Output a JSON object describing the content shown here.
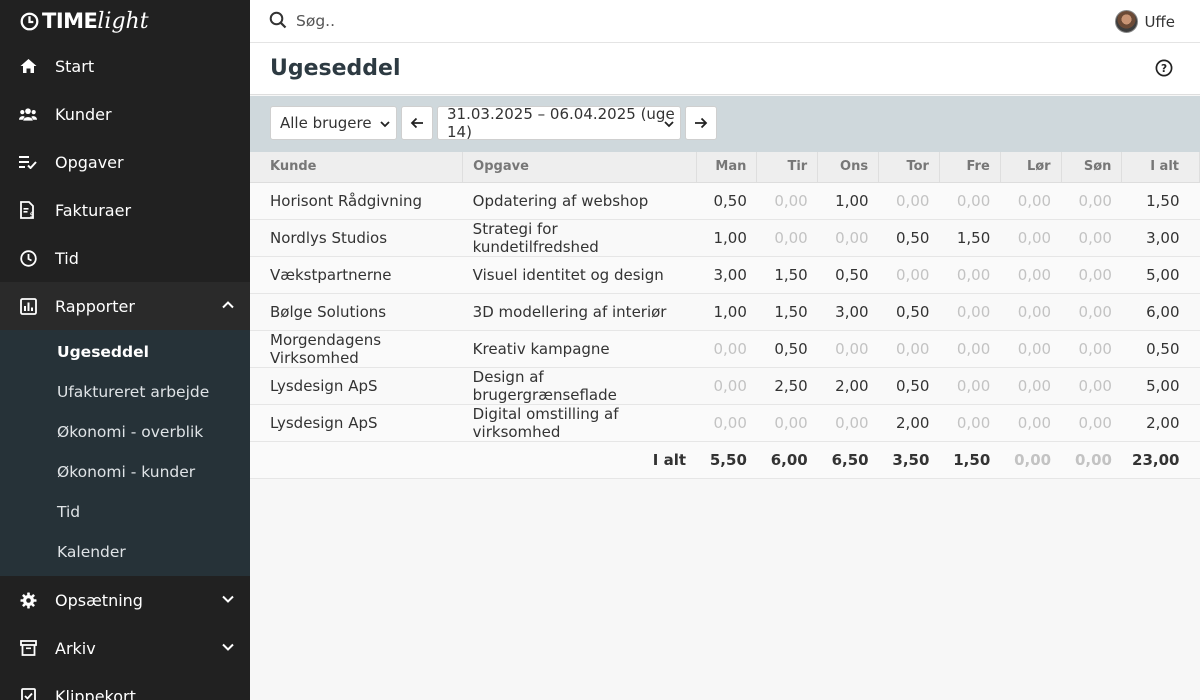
{
  "app": {
    "logo_bold": "TIME",
    "logo_light": "light"
  },
  "sidebar": {
    "items": [
      {
        "label": "Start",
        "icon": "home-icon"
      },
      {
        "label": "Kunder",
        "icon": "users-icon"
      },
      {
        "label": "Opgaver",
        "icon": "tasks-icon"
      },
      {
        "label": "Fakturaer",
        "icon": "invoice-icon"
      },
      {
        "label": "Tid",
        "icon": "clock-icon"
      },
      {
        "label": "Rapporter",
        "icon": "chart-icon",
        "expanded": true
      },
      {
        "label": "Opsætning",
        "icon": "gear-icon"
      },
      {
        "label": "Arkiv",
        "icon": "archive-icon"
      },
      {
        "label": "Klippekort",
        "icon": "card-icon"
      }
    ],
    "sub_items": [
      "Ugeseddel",
      "Ufaktureret arbejde",
      "Økonomi - overblik",
      "Økonomi - kunder",
      "Tid",
      "Kalender"
    ],
    "active_sub": "Ugeseddel"
  },
  "topbar": {
    "search_placeholder": "Søg..",
    "user_name": "Uffe"
  },
  "page": {
    "title": "Ugeseddel"
  },
  "toolbar": {
    "user_filter": "Alle brugere",
    "week_range": "31.03.2025 – 06.04.2025 (uge 14)"
  },
  "table": {
    "headers": [
      "Kunde",
      "Opgave",
      "Man",
      "Tir",
      "Ons",
      "Tor",
      "Fre",
      "Lør",
      "Søn",
      "I alt"
    ],
    "rows": [
      {
        "kunde": "Horisont Rådgivning",
        "opgave": "Opdatering af webshop",
        "days": [
          "0,50",
          "0,00",
          "1,00",
          "0,00",
          "0,00",
          "0,00",
          "0,00"
        ],
        "total": "1,50"
      },
      {
        "kunde": "Nordlys Studios",
        "opgave": "Strategi for kundetilfredshed",
        "days": [
          "1,00",
          "0,00",
          "0,00",
          "0,50",
          "1,50",
          "0,00",
          "0,00"
        ],
        "total": "3,00"
      },
      {
        "kunde": "Vækstpartnerne",
        "opgave": "Visuel identitet og design",
        "days": [
          "3,00",
          "1,50",
          "0,50",
          "0,00",
          "0,00",
          "0,00",
          "0,00"
        ],
        "total": "5,00"
      },
      {
        "kunde": "Bølge Solutions",
        "opgave": "3D modellering af interiør",
        "days": [
          "1,00",
          "1,50",
          "3,00",
          "0,50",
          "0,00",
          "0,00",
          "0,00"
        ],
        "total": "6,00"
      },
      {
        "kunde": "Morgendagens Virksomhed",
        "opgave": "Kreativ kampagne",
        "days": [
          "0,00",
          "0,50",
          "0,00",
          "0,00",
          "0,00",
          "0,00",
          "0,00"
        ],
        "total": "0,50"
      },
      {
        "kunde": "Lysdesign ApS",
        "opgave": "Design af brugergrænseflade",
        "days": [
          "0,00",
          "2,50",
          "2,00",
          "0,50",
          "0,00",
          "0,00",
          "0,00"
        ],
        "total": "5,00"
      },
      {
        "kunde": "Lysdesign ApS",
        "opgave": "Digital omstilling af virksomhed",
        "days": [
          "0,00",
          "0,00",
          "0,00",
          "2,00",
          "0,00",
          "0,00",
          "0,00"
        ],
        "total": "2,00"
      }
    ],
    "footer": {
      "label": "I alt",
      "days": [
        "5,50",
        "6,00",
        "6,50",
        "3,50",
        "1,50",
        "0,00",
        "0,00"
      ],
      "total": "23,00"
    }
  }
}
